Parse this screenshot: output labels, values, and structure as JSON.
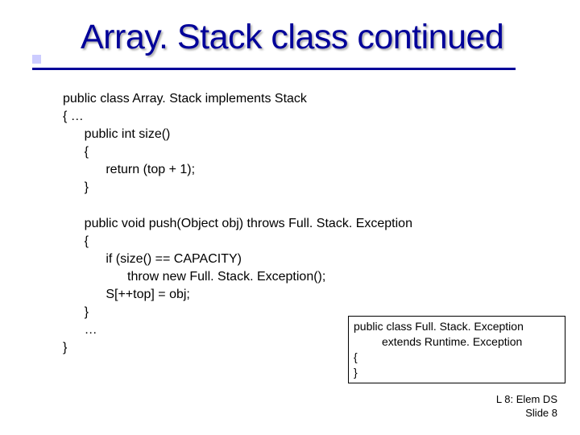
{
  "title": "Array. Stack class continued",
  "code": "public class Array. Stack implements Stack\n{ …\n      public int size()\n      {\n            return (top + 1);\n      }\n\n      public void push(Object obj) throws Full. Stack. Exception\n      {\n            if (size() == CAPACITY)\n                  throw new Full. Stack. Exception();\n            S[++top] = obj;\n      }\n      …\n}",
  "exception_box": "public class Full. Stack. Exception\n         extends Runtime. Exception\n{\n}",
  "footer_line1": "L 8: Elem DS",
  "footer_line2": "Slide 8"
}
